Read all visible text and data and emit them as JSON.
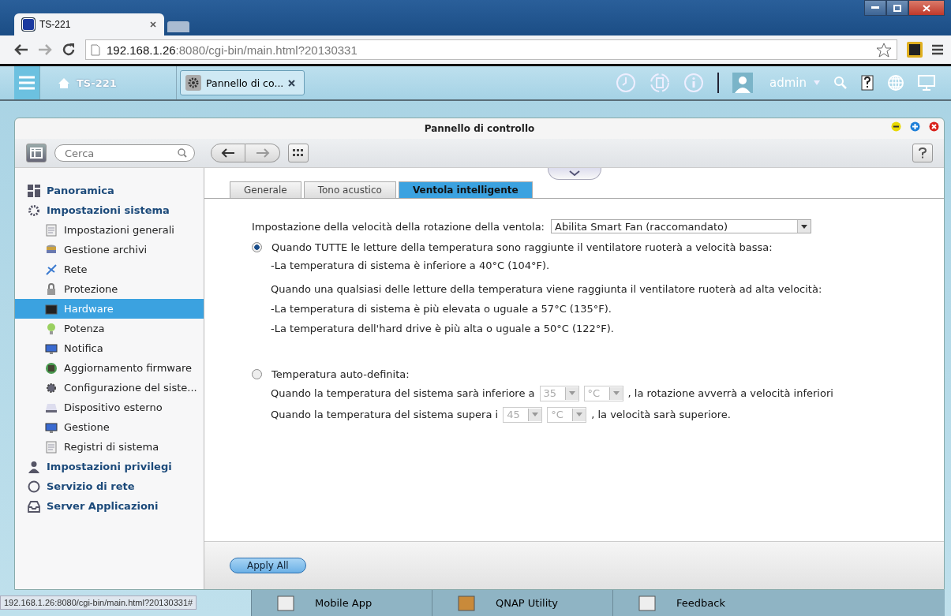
{
  "browser": {
    "tabs": [
      {
        "title": "TS-221",
        "selected": true
      }
    ],
    "url_host": "192.168.1.26",
    "url_rest": ":8080/cgi-bin/main.html?20130331"
  },
  "topbar": {
    "home": "TS-221",
    "app_tab": "Pannello di co...",
    "user": "admin"
  },
  "window": {
    "title": "Pannello di controllo",
    "search": {
      "placeholder": "Cerca"
    }
  },
  "sidebar": {
    "items": [
      {
        "label": "Panoramica",
        "selected": false
      },
      {
        "label": "Impostazioni sistema",
        "selected": false,
        "children": [
          {
            "label": "Impostazioni generali",
            "selected": false
          },
          {
            "label": "Gestione archivi",
            "selected": false
          },
          {
            "label": "Rete",
            "selected": false
          },
          {
            "label": "Protezione",
            "selected": false
          },
          {
            "label": "Hardware",
            "selected": true
          },
          {
            "label": "Potenza",
            "selected": false
          },
          {
            "label": "Notifica",
            "selected": false
          },
          {
            "label": "Aggiornamento firmware",
            "selected": false
          },
          {
            "label": "Configurazione del siste...",
            "selected": false
          },
          {
            "label": "Dispositivo esterno",
            "selected": false
          },
          {
            "label": "Gestione",
            "selected": false
          },
          {
            "label": "Registri di sistema",
            "selected": false
          }
        ]
      },
      {
        "label": "Impostazioni privilegi",
        "selected": false
      },
      {
        "label": "Servizio di rete",
        "selected": false
      },
      {
        "label": "Server Applicazioni",
        "selected": false
      }
    ]
  },
  "tabs": [
    {
      "label": "Generale",
      "selected": false
    },
    {
      "label": "Tono acustico",
      "selected": false
    },
    {
      "label": "Ventola intelligente",
      "selected": true
    }
  ],
  "fan_setting": {
    "label": "Impostazione della velocità della rotazione della ventola:",
    "value": "Abilita Smart Fan (raccomandato)"
  },
  "options": [
    {
      "label": "Quando TUTTE le letture della temperatura sono raggiunte il ventilatore ruoterà a velocità bassa:",
      "selected": true,
      "kind": "text",
      "lines": [
        "-La temperatura di sistema è inferiore a 40°C (104°F).",
        "Quando una qualsiasi delle letture della temperatura viene raggiunta il ventilatore ruoterà ad alta velocità:",
        "-La temperatura di sistema è più elevata o uguale a 57°C (135°F).",
        "-La temperatura dell'hard drive è più alta o uguale a 50°C (122°F)."
      ]
    },
    {
      "label": "Temperatura auto-definita:",
      "selected": false,
      "kind": "form",
      "rows": [
        {
          "before": "Quando la temperatura del sistema sarà inferiore a",
          "value": "35",
          "unit": "°C",
          "after": ", la rotazione avverrà a velocità inferiori"
        },
        {
          "before": "Quando la temperatura del sistema supera i",
          "value": "45",
          "unit": "°C",
          "after": ", la velocità sarà superiore."
        }
      ]
    }
  ],
  "apply_button": "Apply All",
  "desktop_bar": [
    "Mobile App",
    "QNAP Utility",
    "Feedback"
  ],
  "status_url": "192.168.1.26:8080/cgi-bin/main.html?20130331#"
}
